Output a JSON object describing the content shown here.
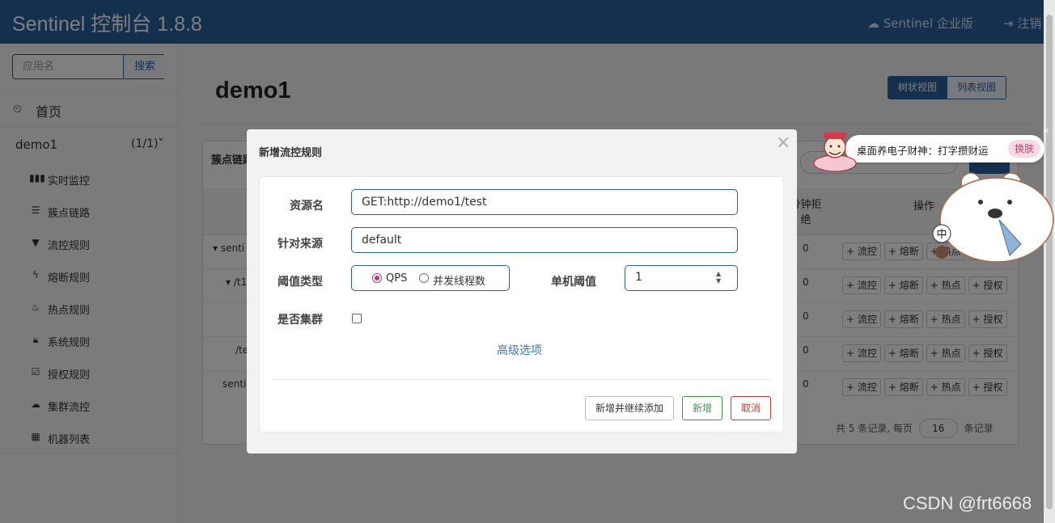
{
  "navbar": {
    "brand": "Sentinel 控制台 1.8.8",
    "enterprise": "Sentinel 企业版",
    "logout": "注销"
  },
  "sidebar": {
    "search_placeholder": "应用名",
    "search_button": "搜索",
    "home": "首页",
    "app": {
      "name": "demo1",
      "count": "(1/1)"
    },
    "menu": [
      {
        "icon": "bar-chart-icon",
        "label": "实时监控"
      },
      {
        "icon": "list-icon",
        "label": "簇点链路"
      },
      {
        "icon": "filter-icon",
        "label": "流控规则"
      },
      {
        "icon": "flash-icon",
        "label": "熔断规则"
      },
      {
        "icon": "fire-icon",
        "label": "热点规则"
      },
      {
        "icon": "lock-icon",
        "label": "系统规则"
      },
      {
        "icon": "check-icon",
        "label": "授权规则"
      },
      {
        "icon": "cloud-icon",
        "label": "集群流控"
      },
      {
        "icon": "grid-icon",
        "label": "机器列表"
      }
    ]
  },
  "main": {
    "title": "demo1",
    "view_tree": "树状视图",
    "view_list": "列表视图",
    "panel_label": "簇点链路",
    "column_reject": "分钟拒绝",
    "column_ops": "操作",
    "rows": [
      {
        "resource": "senti",
        "reject": "0"
      },
      {
        "resource": "/t1",
        "reject": "0"
      },
      {
        "resource": "",
        "reject": "0"
      },
      {
        "resource": "/tes",
        "reject": "0"
      },
      {
        "resource": "sentin",
        "reject": "0"
      }
    ],
    "op_buttons": [
      "+ 流控",
      "+ 熔断",
      "+ 热点",
      "+ 授权"
    ],
    "pager": {
      "prefix": "共 5 条记录, 每页",
      "page_size": "16",
      "suffix": "条记录"
    }
  },
  "modal": {
    "title": "新增流控规则",
    "close": "×",
    "resource_label": "资源名",
    "resource_value": "GET:http://demo1/test",
    "origin_label": "针对来源",
    "origin_value": "default",
    "threshold_type_label": "阈值类型",
    "threshold_options": [
      "QPS",
      "并发线程数"
    ],
    "selected_threshold": "QPS",
    "single_threshold_label": "单机阈值",
    "single_threshold_value": "1",
    "cluster_label": "是否集群",
    "advanced": "高级选项",
    "btn_continue": "新增并继续添加",
    "btn_add": "新增",
    "btn_cancel": "取消"
  },
  "widget": {
    "text": "桌面养电子财神：打字攒财运",
    "skin_button": "换肤",
    "close": "×",
    "badge": "中"
  },
  "watermark": "CSDN @frt6668",
  "colors": {
    "navbar": "#2a5f9e",
    "primary": "#2a5f9e",
    "success": "#3c9a46",
    "danger": "#c63a3a",
    "radio_checked": "#b03a8e"
  }
}
